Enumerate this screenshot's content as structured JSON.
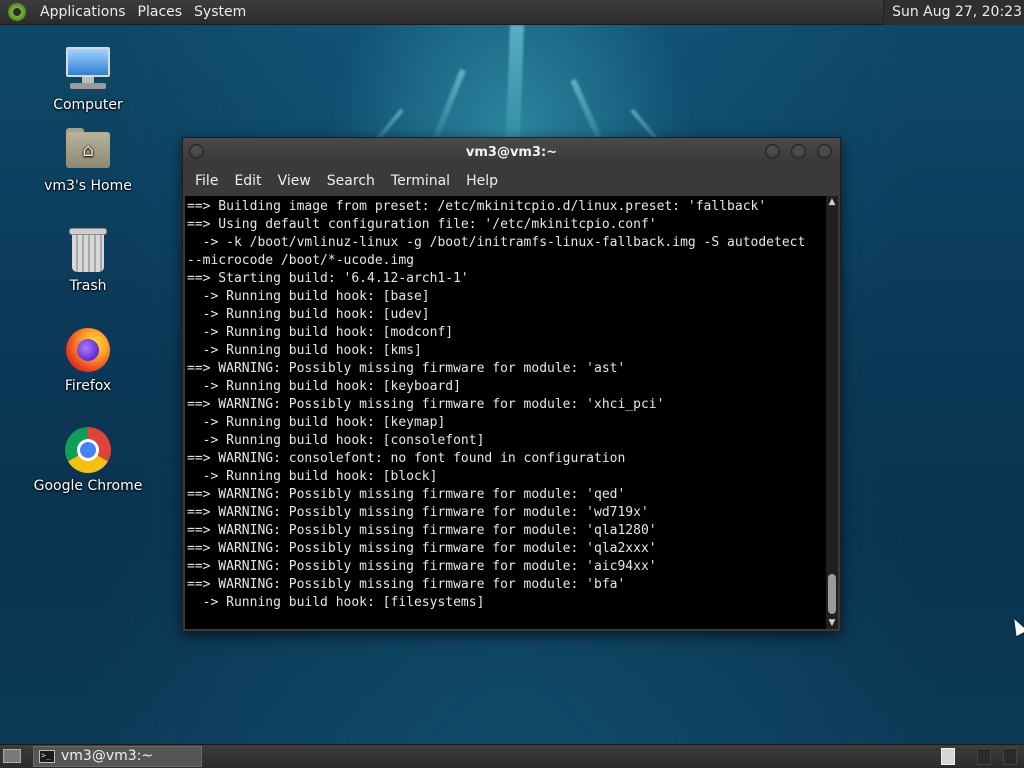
{
  "top_panel": {
    "menus": [
      "Applications",
      "Places",
      "System"
    ],
    "clock": "Sun Aug 27, 20:23"
  },
  "desktop": {
    "icons": [
      {
        "label": "Computer",
        "icon": "computer-icon"
      },
      {
        "label": "vm3's Home",
        "icon": "home-folder-icon"
      },
      {
        "label": "Trash",
        "icon": "trash-icon"
      },
      {
        "label": "Firefox",
        "icon": "firefox-icon"
      },
      {
        "label": "Google Chrome",
        "icon": "chrome-icon"
      }
    ]
  },
  "terminal": {
    "title": "vm3@vm3:~",
    "menus": [
      "File",
      "Edit",
      "View",
      "Search",
      "Terminal",
      "Help"
    ],
    "lines": [
      "==> Building image from preset: /etc/mkinitcpio.d/linux.preset: 'fallback'",
      "==> Using default configuration file: '/etc/mkinitcpio.conf'",
      "  -> -k /boot/vmlinuz-linux -g /boot/initramfs-linux-fallback.img -S autodetect",
      "--microcode /boot/*-ucode.img",
      "==> Starting build: '6.4.12-arch1-1'",
      "  -> Running build hook: [base]",
      "  -> Running build hook: [udev]",
      "  -> Running build hook: [modconf]",
      "  -> Running build hook: [kms]",
      "==> WARNING: Possibly missing firmware for module: 'ast'",
      "  -> Running build hook: [keyboard]",
      "==> WARNING: Possibly missing firmware for module: 'xhci_pci'",
      "  -> Running build hook: [keymap]",
      "  -> Running build hook: [consolefont]",
      "==> WARNING: consolefont: no font found in configuration",
      "  -> Running build hook: [block]",
      "==> WARNING: Possibly missing firmware for module: 'qed'",
      "==> WARNING: Possibly missing firmware for module: 'wd719x'",
      "==> WARNING: Possibly missing firmware for module: 'qla1280'",
      "==> WARNING: Possibly missing firmware for module: 'qla2xxx'",
      "==> WARNING: Possibly missing firmware for module: 'aic94xx'",
      "==> WARNING: Possibly missing firmware for module: 'bfa'",
      "  -> Running build hook: [filesystems]"
    ]
  },
  "taskbar": {
    "tasks": [
      {
        "label": "vm3@vm3:~",
        "icon": "terminal-icon"
      }
    ],
    "task_icon_text": ">_"
  },
  "colors": {
    "panel": "#333333",
    "terminal_bg": "#000000",
    "terminal_fg": "#e6e6e6"
  }
}
